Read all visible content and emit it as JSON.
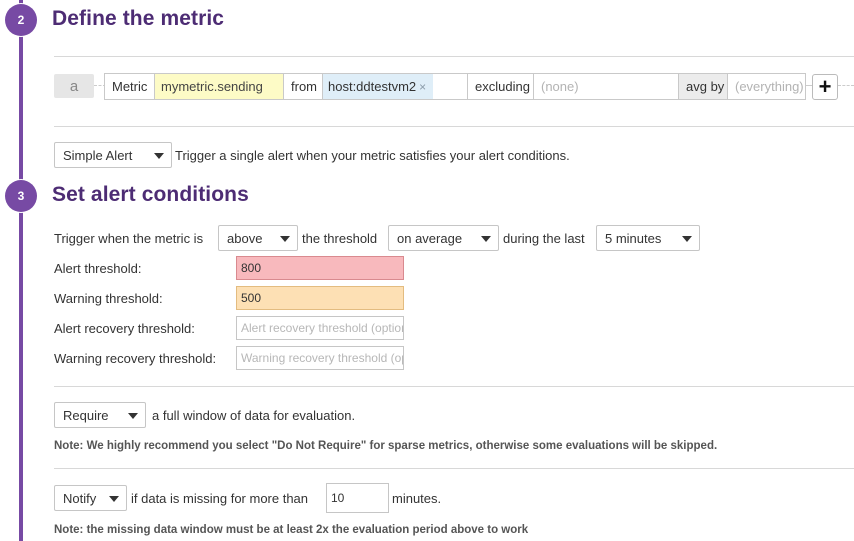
{
  "steps": {
    "define": {
      "number": "2",
      "title": "Define the metric"
    },
    "conditions": {
      "number": "3",
      "title": "Set alert conditions"
    }
  },
  "query": {
    "letter": "a",
    "metric_label": "Metric",
    "metric_value": "mymetric.sending",
    "from_label": "from",
    "from_tag": "host:ddtestvm2",
    "from_tag_remove": "×",
    "excluding_label": "excluding",
    "excluding_placeholder": "(none)",
    "avg_by_label": "avg by",
    "avg_by_placeholder": "(everything)",
    "add_symbol": "+"
  },
  "alert_type": {
    "selected": "Simple Alert",
    "description": "Trigger a single alert when your metric satisfies your alert conditions."
  },
  "trigger": {
    "prefix": "Trigger when the metric is",
    "comparator": "above",
    "threshold_text": "the threshold",
    "aggregation": "on average",
    "during_text": "during the last",
    "window": "5 minutes"
  },
  "thresholds": {
    "alert_label": "Alert threshold:",
    "alert_value": "800",
    "warning_label": "Warning threshold:",
    "warning_value": "500",
    "alert_recovery_label": "Alert recovery threshold:",
    "alert_recovery_placeholder": "Alert recovery threshold (optional)",
    "warning_recovery_label": "Warning recovery threshold:",
    "warning_recovery_placeholder": "Warning recovery threshold (optional)"
  },
  "data_window": {
    "selected": "Require",
    "text": "a full window of data for evaluation.",
    "note": "Note: We highly recommend you select \"Do Not Require\" for sparse metrics, otherwise some evaluations will be skipped."
  },
  "missing_data": {
    "selected": "Notify",
    "text": "if data is missing for more than",
    "value": "10",
    "unit": "minutes.",
    "note": "Note: the missing data window must be at least 2x the evaluation period above to work"
  },
  "colors": {
    "accent": "#774aa4",
    "title": "#4d2c74",
    "alert_field": "#f8b9bd",
    "warning_field": "#fde0b4",
    "metric_highlight": "#fdfbc6",
    "tag_highlight": "#dfeef8"
  }
}
